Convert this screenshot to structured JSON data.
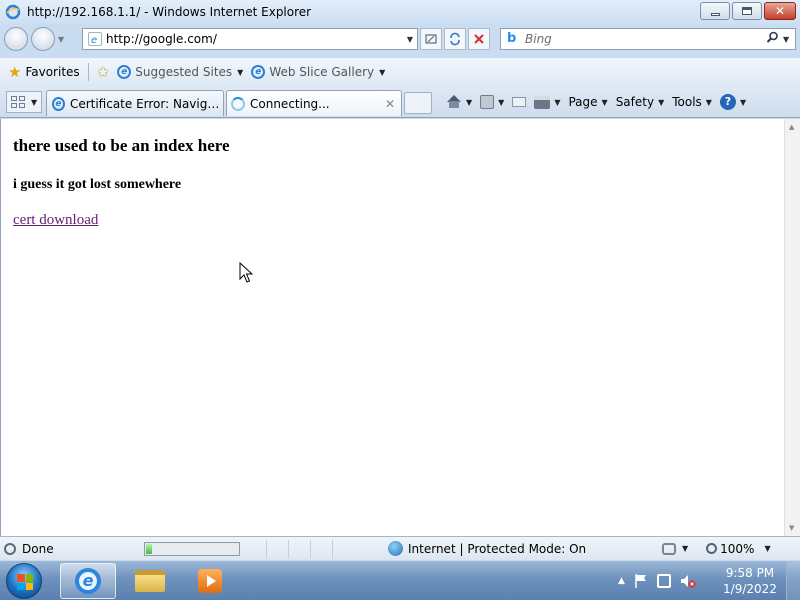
{
  "window": {
    "title": "http://192.168.1.1/ - Windows Internet Explorer"
  },
  "address_bar": {
    "url": "http://google.com/",
    "search_placeholder": "Bing"
  },
  "favorites_bar": {
    "favorites_label": "Favorites",
    "suggested_sites_label": "Suggested Sites",
    "web_slice_gallery_label": "Web Slice Gallery"
  },
  "tabs": [
    {
      "label": "Certificate Error: Navigatio..."
    },
    {
      "label": "Connecting..."
    }
  ],
  "command_bar": {
    "page_label": "Page",
    "safety_label": "Safety",
    "tools_label": "Tools"
  },
  "page": {
    "heading": "there used to be an index here",
    "subheading": "i guess it got lost somewhere",
    "link_text": "cert download"
  },
  "status_bar": {
    "status_text": "Done",
    "zone_text": "Internet | Protected Mode: On",
    "zoom_text": "100%",
    "progress_fraction": 0.06
  },
  "taskbar": {
    "time": "9:58 PM",
    "date": "1/9/2022"
  },
  "colors": {
    "link_visited": "#6a1b77",
    "window_frame": "#c9dcf0",
    "close_button": "#c3402c"
  }
}
